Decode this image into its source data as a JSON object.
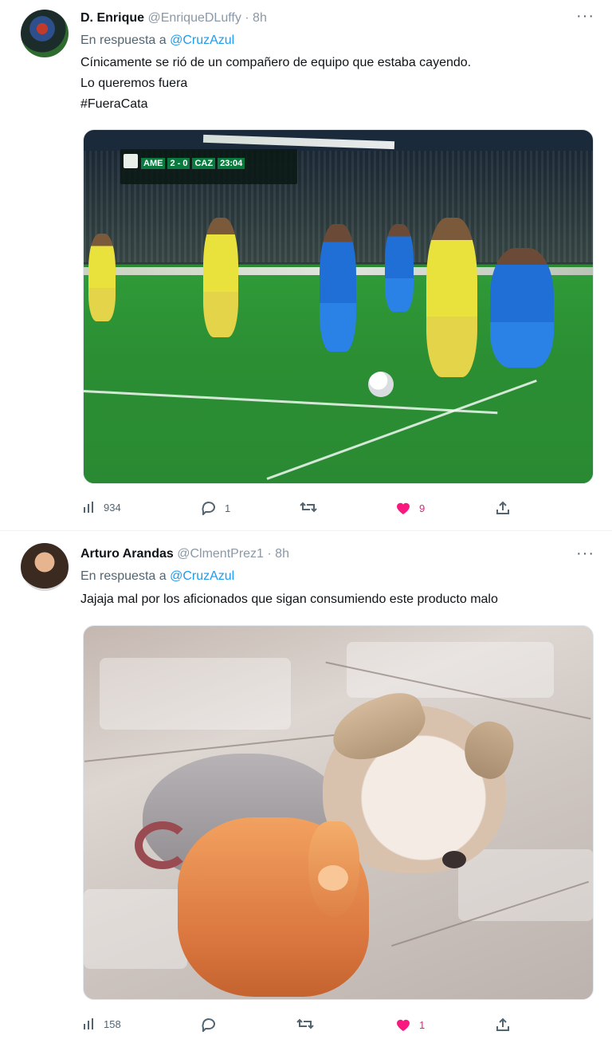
{
  "tweets": [
    {
      "name": "D. Enrique",
      "handle": "@EnriqueDLuffy",
      "sep": "·",
      "time": "8h",
      "more": "···",
      "reply_prefix": "En respuesta a",
      "reply_to": "@CruzAzul",
      "text_lines": [
        "Cínicamente se rió de un compañero de equipo que estaba cayendo.",
        "Lo queremos fuera"
      ],
      "hashtag": "#FueraCata",
      "media": {
        "scorebug": {
          "home": "AME",
          "score": "2 - 0",
          "away": "CAZ",
          "clock": "23:04"
        }
      },
      "stats": {
        "views": "934",
        "replies": "1",
        "retweets": "",
        "likes": "9"
      }
    },
    {
      "name": "Arturo Arandas",
      "handle": "@ClmentPrez1",
      "sep": "·",
      "time": "8h",
      "more": "···",
      "reply_prefix": "En respuesta a",
      "reply_to": "@CruzAzul",
      "text_lines": [
        "Jajaja mal por los aficionados que sigan consumiendo este producto malo"
      ],
      "stats": {
        "views": "158",
        "replies": "",
        "retweets": "",
        "likes": "1"
      }
    }
  ],
  "colors": {
    "accent": "#1d9bf0",
    "like": "#f91880",
    "muted": "#536471"
  },
  "icons": [
    "views-icon",
    "reply-icon",
    "retweet-icon",
    "like-icon",
    "share-icon",
    "more-icon"
  ]
}
